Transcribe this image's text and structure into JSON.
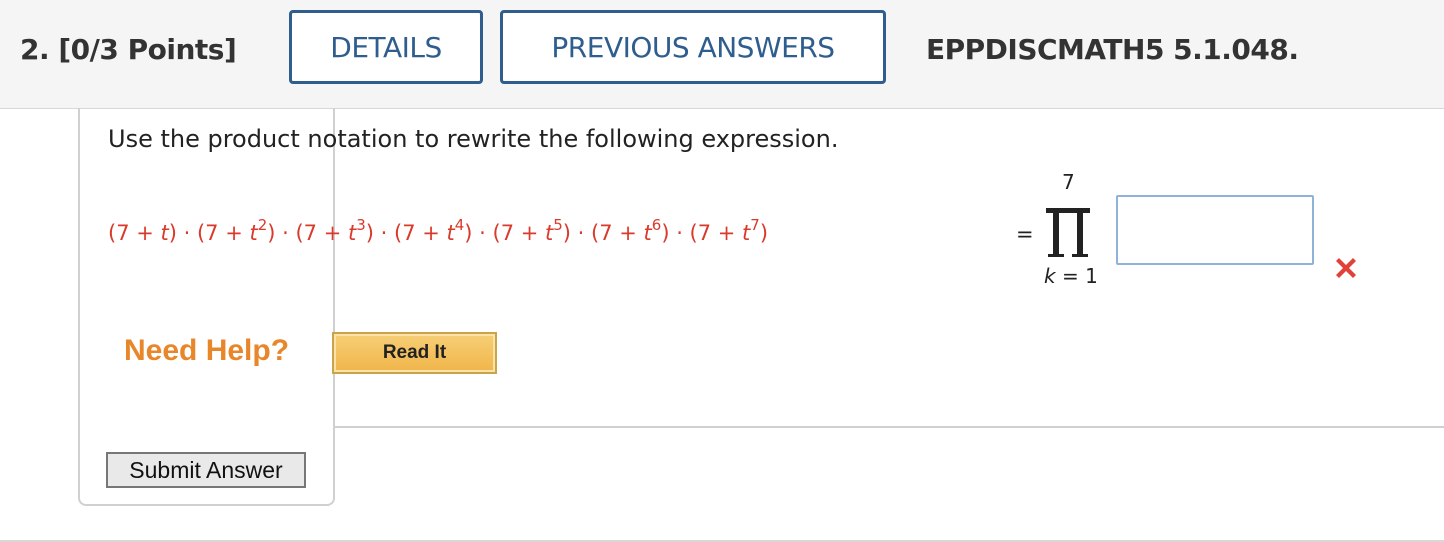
{
  "header": {
    "question_number": "2.",
    "points": "[0/3 Points]",
    "details_label": "DETAILS",
    "previous_answers_label": "PREVIOUS ANSWERS",
    "question_id": "EPPDISCMATH5 5.1.048."
  },
  "question": {
    "prompt": "Use the product notation to rewrite the following expression.",
    "expression_terms": [
      {
        "base": "(7 + t",
        "exp": ""
      },
      {
        "base": "(7 + t",
        "exp": "2"
      },
      {
        "base": "(7 + t",
        "exp": "3"
      },
      {
        "base": "(7 + t",
        "exp": "4"
      },
      {
        "base": "(7 + t",
        "exp": "5"
      },
      {
        "base": "(7 + t",
        "exp": "6"
      },
      {
        "base": "(7 + t",
        "exp": "7"
      }
    ],
    "equals": "=",
    "product_upper": "7",
    "product_lower": "k = 1",
    "answer_value": "",
    "answer_status_icon": "incorrect-x-icon"
  },
  "help": {
    "need_help_label": "Need Help?",
    "read_it_label": "Read It"
  },
  "actions": {
    "submit_label": "Submit Answer"
  },
  "colors": {
    "accent": "#2e5d8e",
    "expression": "#d93a2b",
    "need_help": "#e8862a",
    "incorrect": "#e0423a"
  }
}
